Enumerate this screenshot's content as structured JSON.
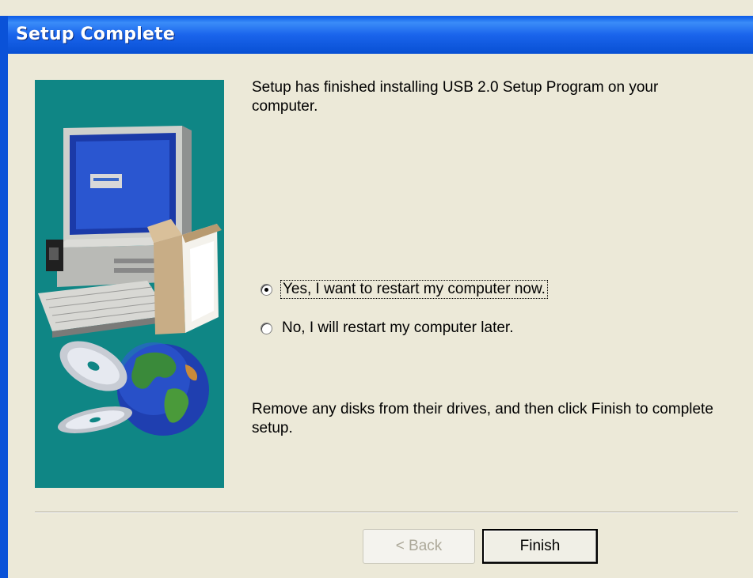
{
  "window": {
    "title": "Setup Complete"
  },
  "content": {
    "intro_text": "Setup has finished installing USB 2.0 Setup Program on your computer.",
    "options": [
      {
        "label": "Yes, I want to restart my computer now.",
        "selected": true
      },
      {
        "label": "No, I will restart my computer later.",
        "selected": false
      }
    ],
    "instruction_text": "Remove any disks from their drives, and then click Finish to complete setup."
  },
  "buttons": {
    "back_label": "< Back",
    "finish_label": "Finish",
    "back_enabled": false
  },
  "colors": {
    "titlebar": "#0a5ae8",
    "dialog_bg": "#ece9d8",
    "art_bg": "#0f8685"
  },
  "icons": {
    "art_panel": [
      "computer-icon",
      "keyboard-icon",
      "box-icon",
      "cd-icon",
      "globe-icon"
    ]
  }
}
